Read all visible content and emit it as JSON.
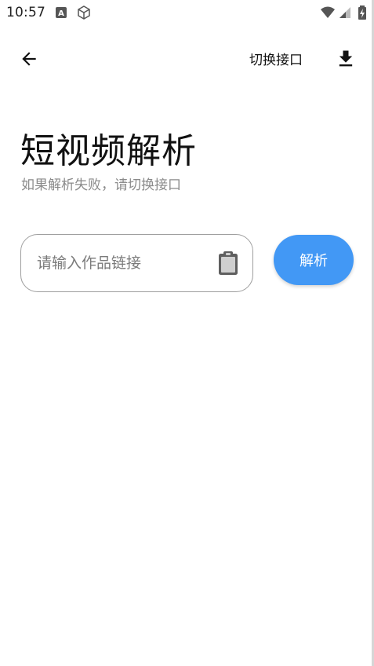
{
  "status_bar": {
    "time": "10:57",
    "icons": [
      "app-notification-icon",
      "box-icon",
      "wifi-icon",
      "signal-icon",
      "battery-charging-icon"
    ]
  },
  "top_bar": {
    "back_icon": "arrow-left-icon",
    "switch_api_label": "切换接口",
    "download_icon": "download-icon"
  },
  "header": {
    "title": "短视频解析",
    "subtitle": "如果解析失败，请切换接口"
  },
  "form": {
    "link_placeholder": "请输入作品链接",
    "link_value": "",
    "paste_icon": "clipboard-icon",
    "parse_label": "解析"
  },
  "colors": {
    "accent": "#4298f5",
    "subtitle": "#8a8a8a",
    "border": "#9e9e9e"
  }
}
